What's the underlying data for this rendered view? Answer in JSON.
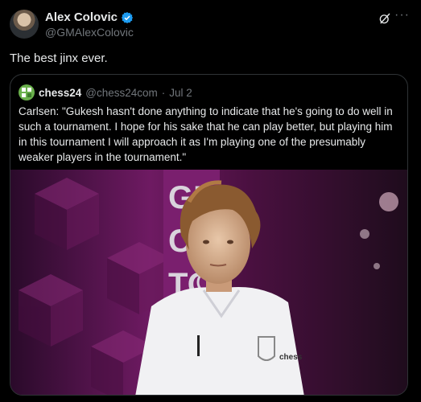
{
  "author": {
    "display_name": "Alex Colovic",
    "handle": "@GMAlexColovic",
    "verified": true
  },
  "tweet": {
    "text": "The best jinx ever."
  },
  "quoted": {
    "display_name": "chess24",
    "handle": "@chess24com",
    "separator": "·",
    "date": "Jul 2",
    "text": "Carlsen: \"Gukesh hasn't done anything to indicate that he's going to do well in such a tournament. I hope for his sake that he can play better, but playing him in this tournament I will approach it as I'm playing one of the presumably weaker players in the tournament.\"",
    "media": {
      "banner_lines": [
        "GR",
        "CH",
        "TO"
      ],
      "shirt_brand": "chess"
    }
  },
  "icons": {
    "verified": "verified-badge-icon",
    "grok": "grok-icon",
    "more": "more-options-icon"
  },
  "colors": {
    "background": "#000000",
    "text": "#e7e9ea",
    "muted": "#71767b",
    "verified": "#1d9bf0",
    "chess24_green": "#6ab04c",
    "banner_magenta": "#7a1f6e"
  }
}
